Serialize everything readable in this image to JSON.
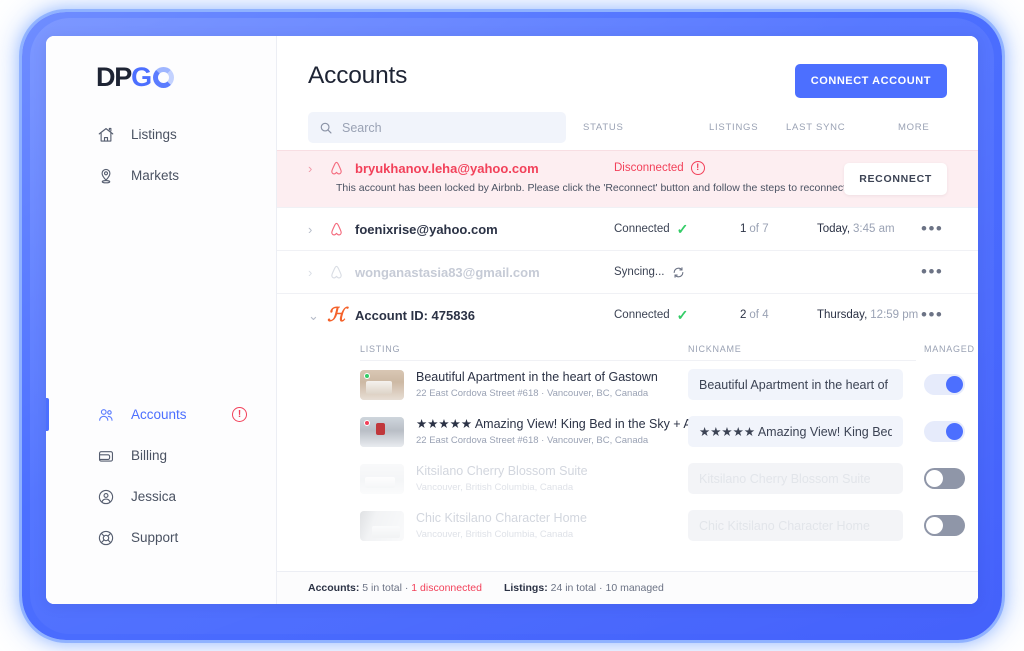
{
  "sidebar": {
    "logo": {
      "dark": "DP",
      "blue": "G",
      "mark": "o-ring-icon"
    },
    "top_items": [
      {
        "label": "Listings",
        "icon": "home-icon"
      },
      {
        "label": "Markets",
        "icon": "map-pin-icon"
      }
    ],
    "bottom_items": [
      {
        "label": "Accounts",
        "icon": "users-icon",
        "active": true,
        "alert": "!"
      },
      {
        "label": "Billing",
        "icon": "wallet-icon"
      },
      {
        "label": "Jessica",
        "icon": "user-circle-icon"
      },
      {
        "label": "Support",
        "icon": "lifebuoy-icon"
      }
    ]
  },
  "header": {
    "title": "Accounts",
    "connect_button": "CONNECT ACCOUNT"
  },
  "toolbar": {
    "search_placeholder": "Search",
    "search_value": "",
    "columns": [
      "STATUS",
      "LISTINGS",
      "LAST SYNC",
      "MORE"
    ]
  },
  "accounts": [
    {
      "name": "bryukhanov.leha@yahoo.com",
      "brand": "airbnb-icon",
      "status": "Disconnected",
      "status_icon": "warning-icon",
      "listings": "",
      "listings_total": "",
      "last_sync": "",
      "last_sync_time": "",
      "note": "This account has been locked by Airbnb. Please click the 'Reconnect' button and follow the steps to reconnect it to DPGO.",
      "action_button": "RECONNECT",
      "more": "•••"
    },
    {
      "name": "foenixrise@yahoo.com",
      "brand": "airbnb-icon",
      "status": "Connected",
      "status_icon": "check-icon",
      "listings": "1",
      "listings_total": "of 7",
      "last_sync": "Today,",
      "last_sync_time": "3:45 am",
      "more": "•••"
    },
    {
      "name": "wonganastasia83@gmail.com",
      "brand": "airbnb-icon",
      "status": "Syncing...",
      "status_icon": "sync-icon",
      "listings": "",
      "listings_total": "",
      "last_sync": "",
      "last_sync_time": "",
      "more": "•••"
    },
    {
      "name": "Account ID: 475836",
      "brand": "hostaway-h-icon",
      "status": "Connected",
      "status_icon": "check-icon",
      "listings": "2",
      "listings_total": "of 4",
      "last_sync": "Thursday,",
      "last_sync_time": "12:59 pm",
      "more": "•••"
    }
  ],
  "listings_panel": {
    "columns": [
      "LISTING",
      "NICKNAME",
      "MANAGED"
    ],
    "rows": [
      {
        "title": "Beautiful Apartment in the heart of Gastown",
        "address": "22 East Cordova Street #618 · Vancouver, BC, Canada",
        "nickname": "Beautiful Apartment in the heart of Ga",
        "managed": true,
        "dot": "#33cc66",
        "dimmed": false
      },
      {
        "title": "★★★★★ Amazing View! King Bed in the Sky + AC",
        "address": "22 East Cordova Street #618 · Vancouver, BC, Canada",
        "nickname": "★★★★★ Amazing View! King Bed in",
        "managed": true,
        "dot": "#f2415a",
        "dimmed": false
      },
      {
        "title": "Kitsilano Cherry Blossom Suite",
        "address": "Vancouver, British Columbia, Canada",
        "nickname": "Kitsilano Cherry Blossom Suite",
        "managed": false,
        "dot": "",
        "dimmed": true
      },
      {
        "title": "Chic Kitsilano Character Home",
        "address": "Vancouver, British Columbia, Canada",
        "nickname": "Chic Kitsilano Character Home",
        "managed": false,
        "dot": "",
        "dimmed": true
      }
    ]
  },
  "footer": {
    "accounts_label": "Accounts:",
    "accounts_value": "5 in total · ",
    "accounts_alert": "1 disconnected",
    "listings_label": "Listings:",
    "listings_value": "24 in total · 10 managed"
  },
  "colors": {
    "accent": "#4c6fff",
    "danger": "#f2415a",
    "success": "#33cc66",
    "frame": "#4c6fff"
  }
}
